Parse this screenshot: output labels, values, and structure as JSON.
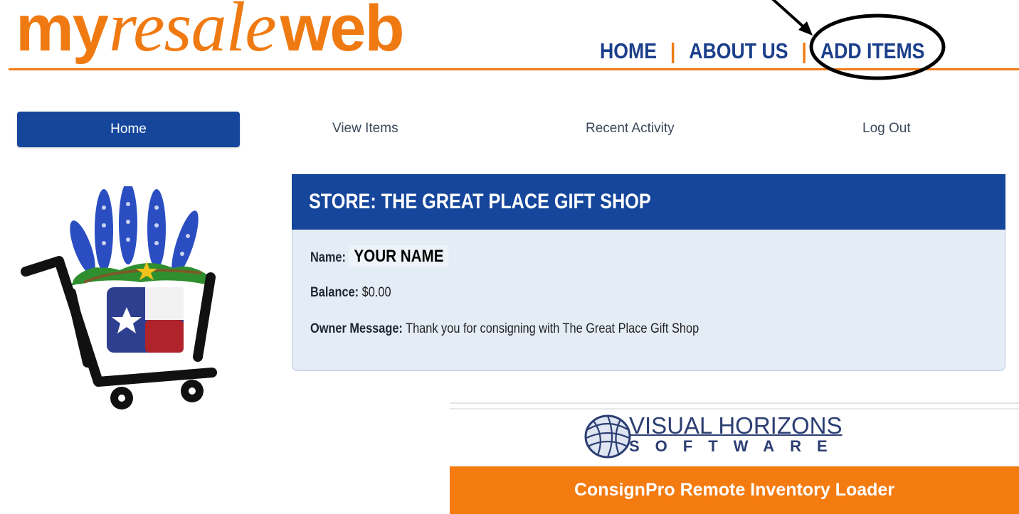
{
  "brand": {
    "my": "my",
    "resale": "resale",
    "web": "web",
    "accent_color": "#f07a12"
  },
  "top_nav": {
    "items": [
      {
        "label": "HOME"
      },
      {
        "label": "ABOUT US"
      },
      {
        "label": "ADD ITEMS"
      }
    ],
    "separator": "|",
    "highlighted": "ADD ITEMS"
  },
  "sub_nav": {
    "items": [
      {
        "label": "Home",
        "active": true
      },
      {
        "label": "View Items"
      },
      {
        "label": "Recent Activity"
      },
      {
        "label": "Log Out"
      }
    ]
  },
  "store": {
    "title": "STORE: THE GREAT PLACE GIFT SHOP",
    "name_label": "Name:",
    "name_value": "YOUR NAME",
    "balance_label": "Balance:",
    "balance_value": "$0.00",
    "owner_message_label": "Owner Message:",
    "owner_message_value": "Thank you for consigning with The Great Place Gift Shop"
  },
  "footer": {
    "company_line1": "VISUAL HORIZONS",
    "company_line2": "SOFTWARE",
    "banner": "ConsignPro Remote Inventory Loader"
  },
  "colors": {
    "primary_blue": "#15469b",
    "orange": "#f47b10",
    "panel_bg": "#e4ecf6"
  },
  "icons": [
    "shopping-cart-icon",
    "bluebonnet-flowers-icon",
    "texas-flag-icon",
    "globe-icon",
    "arrow-icon"
  ]
}
